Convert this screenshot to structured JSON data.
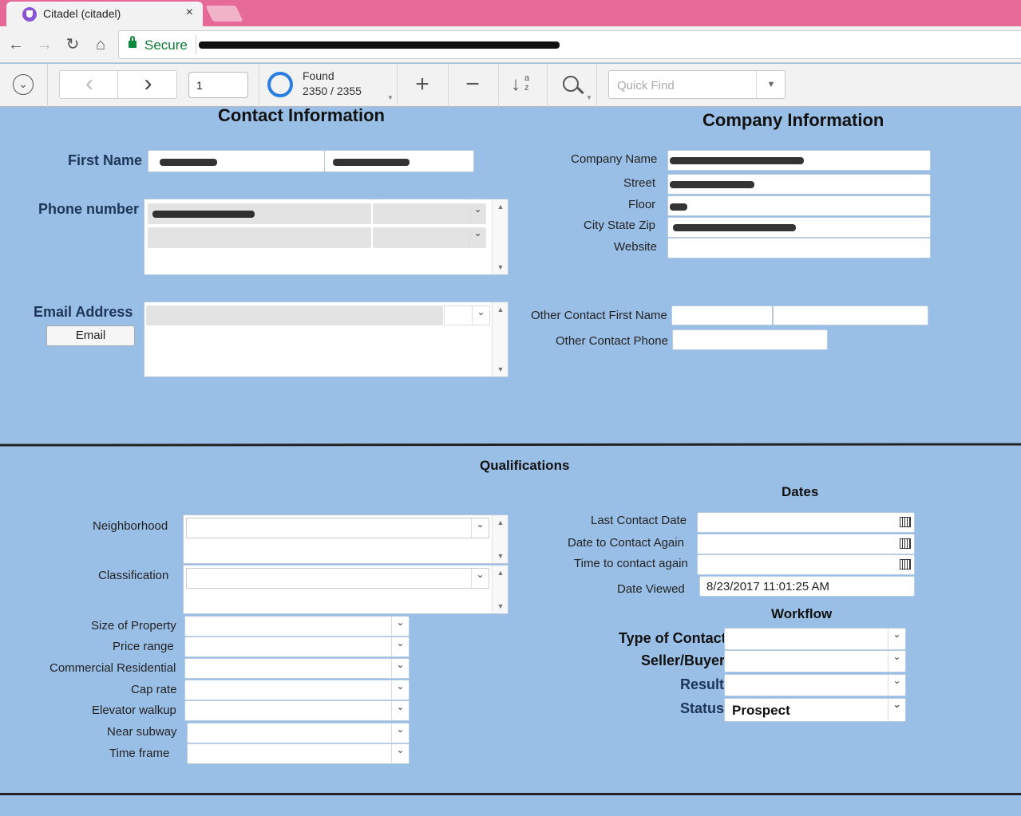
{
  "browser": {
    "tab_title": "Citadel (citadel)",
    "tab_close": "×",
    "secure_label": "Secure"
  },
  "toolbar": {
    "record_number": "1",
    "found_label": "Found",
    "found_count": "2350 / 2355",
    "quick_find_placeholder": "Quick Find"
  },
  "contact": {
    "heading": "Contact Information",
    "first_name_label": "First Name",
    "phone_label": "Phone number",
    "email_label": "Email Address",
    "email_button": "Email"
  },
  "company": {
    "heading": "Company Information",
    "name_label": "Company Name",
    "street_label": "Street",
    "floor_label": "Floor",
    "city_label": "City State Zip",
    "website_label": "Website",
    "other_first_label": "Other Contact First Name",
    "other_phone_label": "Other Contact Phone"
  },
  "qualifications": {
    "heading": "Qualifications",
    "neighborhood_label": "Neighborhood",
    "classification_label": "Classification",
    "size_label": "Size of Property",
    "price_label": "Price range",
    "commercial_label": "Commercial Residential",
    "cap_label": "Cap rate",
    "elevator_label": "Elevator walkup",
    "subway_label": "Near subway",
    "timeframe_label": "Time frame"
  },
  "dates": {
    "heading": "Dates",
    "last_contact_label": "Last Contact Date",
    "contact_again_label": "Date to Contact Again",
    "time_again_label": "Time to contact again",
    "viewed_label": "Date Viewed",
    "viewed_value": "8/23/2017 11:01:25 AM"
  },
  "workflow": {
    "heading": "Workflow",
    "type_label": "Type of Contact",
    "seller_label": "Seller/Buyer",
    "result_label": "Result",
    "status_label": "Status",
    "status_value": "Prospect"
  },
  "icons": {
    "back": "←",
    "forward": "→",
    "reload": "↻",
    "home": "⌂",
    "menu": "⌄",
    "prev": "‹",
    "next": "›",
    "new_record": "+",
    "delete_record": "−",
    "sort": "↓",
    "find": "⌕",
    "dropdown": "⌄",
    "up_arrow": "▲",
    "down_arrow": "▼"
  }
}
